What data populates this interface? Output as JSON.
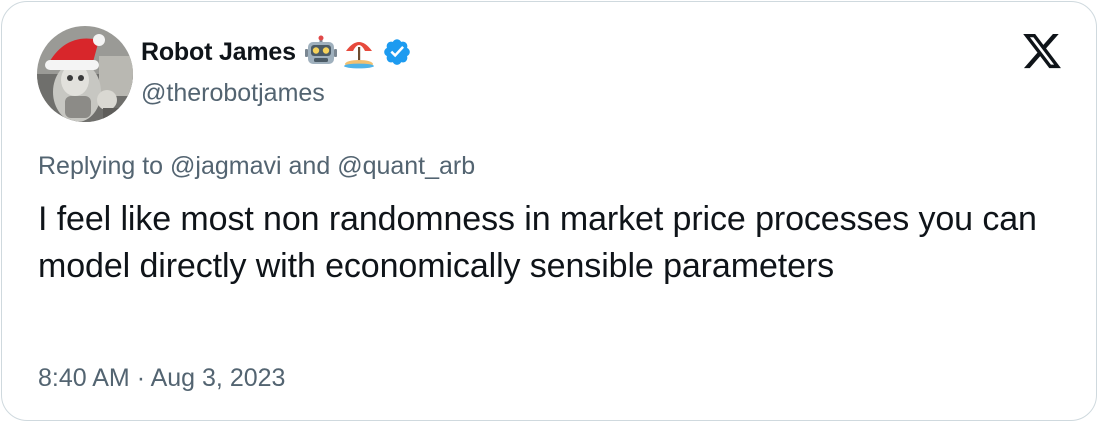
{
  "author": {
    "display_name": "Robot James",
    "handle": "@therobotjames",
    "name_emojis": [
      "robot-face-icon",
      "beach-umbrella-icon"
    ],
    "verified": true,
    "verified_color": "#1d9bf0"
  },
  "reply_context": {
    "prefix": "Replying to",
    "mention_1": "@jagmavi",
    "conjunction": "and",
    "mention_2": "@quant_arb"
  },
  "tweet": {
    "text": "I feel like most non randomness in market price processes you can model directly with economically sensible parameters",
    "time": "8:40 AM",
    "separator": "·",
    "date": "Aug 3, 2023"
  },
  "brand": {
    "logo": "x-logo-icon",
    "text_color": "#0f1419",
    "secondary_color": "#536471",
    "border_color": "#cfd9de"
  }
}
